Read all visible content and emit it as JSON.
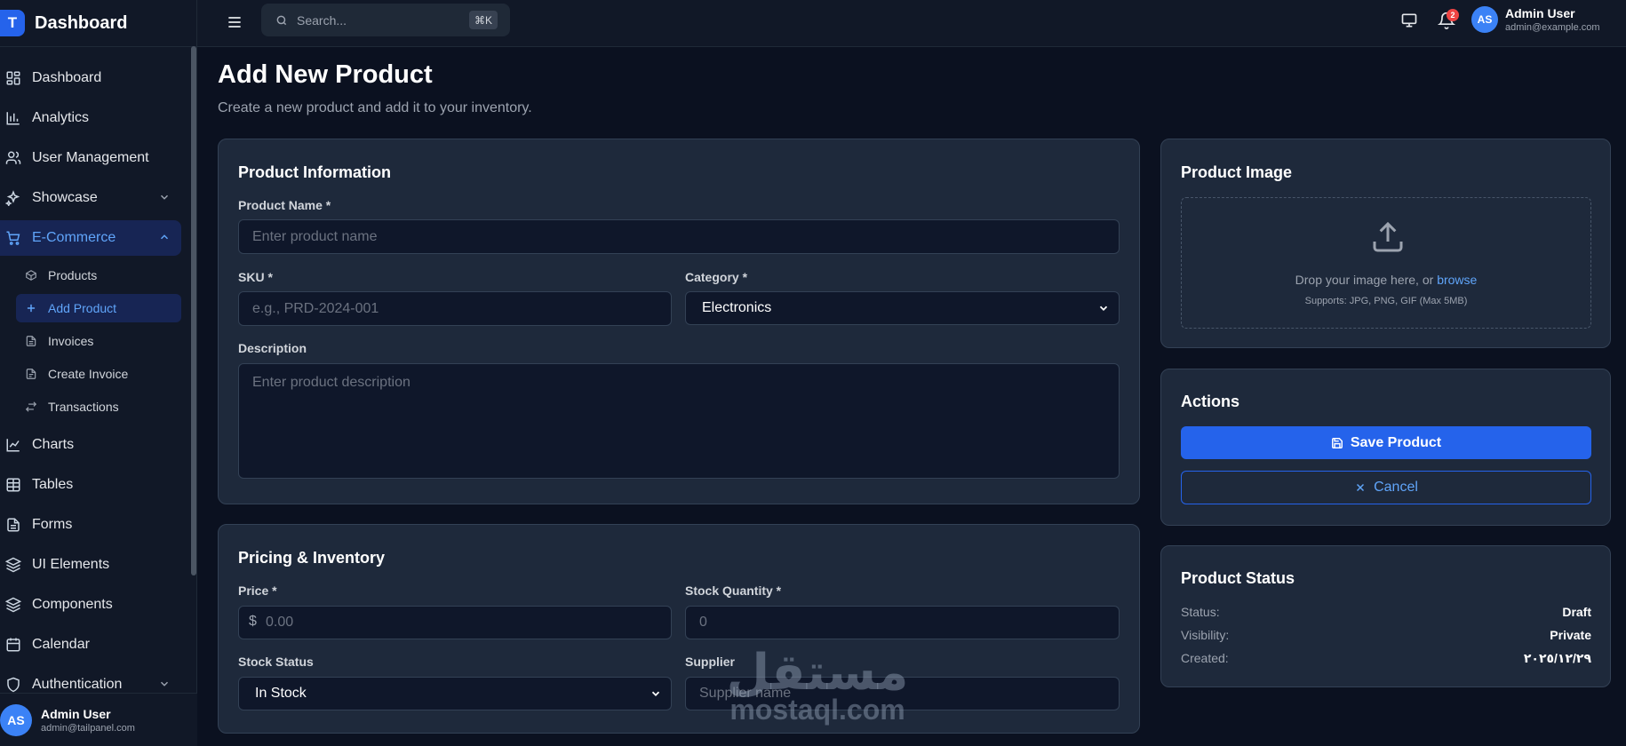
{
  "brand": {
    "logo": "T",
    "name": "Dashboard"
  },
  "sidebar": {
    "items": [
      {
        "label": "Dashboard",
        "icon": "grid-icon"
      },
      {
        "label": "Analytics",
        "icon": "bar-chart-icon"
      },
      {
        "label": "User Management",
        "icon": "users-icon"
      },
      {
        "label": "Showcase",
        "icon": "sparkles-icon"
      },
      {
        "label": "E-Commerce",
        "icon": "cart-icon"
      },
      {
        "label": "Charts",
        "icon": "line-chart-icon"
      },
      {
        "label": "Tables",
        "icon": "table-icon"
      },
      {
        "label": "Forms",
        "icon": "file-icon"
      },
      {
        "label": "UI Elements",
        "icon": "layers-icon"
      },
      {
        "label": "Components",
        "icon": "layers-icon"
      },
      {
        "label": "Calendar",
        "icon": "calendar-icon"
      },
      {
        "label": "Authentication",
        "icon": "shield-icon"
      }
    ],
    "ecommerce_sub": [
      {
        "label": "Products",
        "icon": "box-icon"
      },
      {
        "label": "Add Product",
        "icon": "plus-icon"
      },
      {
        "label": "Invoices",
        "icon": "file-icon"
      },
      {
        "label": "Create Invoice",
        "icon": "file-plus-icon"
      },
      {
        "label": "Transactions",
        "icon": "swap-icon"
      }
    ],
    "user": {
      "initials": "AS",
      "name": "Admin User",
      "email": "admin@tailpanel.com"
    }
  },
  "topbar": {
    "search_placeholder": "Search...",
    "shortcut": "⌘K",
    "notification_count": "2",
    "user": {
      "initials": "AS",
      "name": "Admin User",
      "email": "admin@example.com"
    }
  },
  "page": {
    "title": "Add New Product",
    "subtitle": "Create a new product and add it to your inventory."
  },
  "product_info": {
    "title": "Product Information",
    "name_label": "Product Name *",
    "name_placeholder": "Enter product name",
    "sku_label": "SKU *",
    "sku_placeholder": "e.g., PRD-2024-001",
    "category_label": "Category *",
    "category_value": "Electronics",
    "description_label": "Description",
    "description_placeholder": "Enter product description"
  },
  "pricing": {
    "title": "Pricing & Inventory",
    "price_label": "Price *",
    "price_prefix": "$",
    "price_placeholder": "0.00",
    "stock_label": "Stock Quantity *",
    "stock_placeholder": "0",
    "stock_status_label": "Stock Status",
    "stock_status_value": "In Stock",
    "supplier_label": "Supplier",
    "supplier_placeholder": "Supplier name"
  },
  "product_image": {
    "title": "Product Image",
    "drop_text": "Drop your image here, or",
    "browse": "browse",
    "hint": "Supports: JPG, PNG, GIF (Max 5MB)"
  },
  "actions": {
    "title": "Actions",
    "save": "Save Product",
    "cancel": "Cancel"
  },
  "status": {
    "title": "Product Status",
    "rows": [
      {
        "key": "Status:",
        "value": "Draft"
      },
      {
        "key": "Visibility:",
        "value": "Private"
      },
      {
        "key": "Created:",
        "value": "٢٠٢٥/١٢/٢٩"
      }
    ]
  },
  "watermark": {
    "arabic": "مستقل",
    "latin": "mostaql.com"
  },
  "colors": {
    "accent": "#2563eb",
    "background": "#0b1120",
    "card": "#1e293b",
    "badge": "#ef4444"
  }
}
